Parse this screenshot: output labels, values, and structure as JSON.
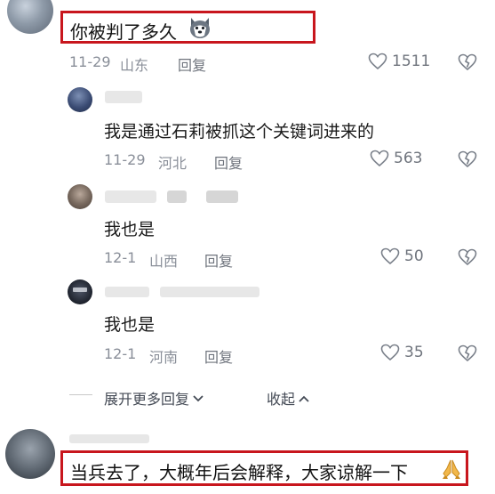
{
  "top_comment": {
    "text": "你被判了多久",
    "date": "11-29",
    "location": "山东",
    "reply_label": "回复",
    "likes": "1511"
  },
  "replies": [
    {
      "text": "我是通过石莉被抓这个关键词进来的",
      "date": "11-29",
      "location": "河北",
      "reply_label": "回复",
      "likes": "563"
    },
    {
      "text": "我也是",
      "date": "12-1",
      "location": "山西",
      "reply_label": "回复",
      "likes": "50"
    },
    {
      "text": "我也是",
      "date": "12-1",
      "location": "河南",
      "reply_label": "回复",
      "likes": "35"
    }
  ],
  "controls": {
    "expand_more": "展开更多回复",
    "collapse": "收起"
  },
  "bottom_comment": {
    "text": "当兵去了，大概年后会解释，大家谅解一下"
  },
  "colors": {
    "highlight_border": "#c8161d",
    "meta_text": "#8a8f99"
  },
  "icons": {
    "husky_emoji": "dog-face-icon",
    "pray_emoji": "folded-hands-icon",
    "like": "heart-outline-icon",
    "dislike": "broken-heart-icon"
  }
}
